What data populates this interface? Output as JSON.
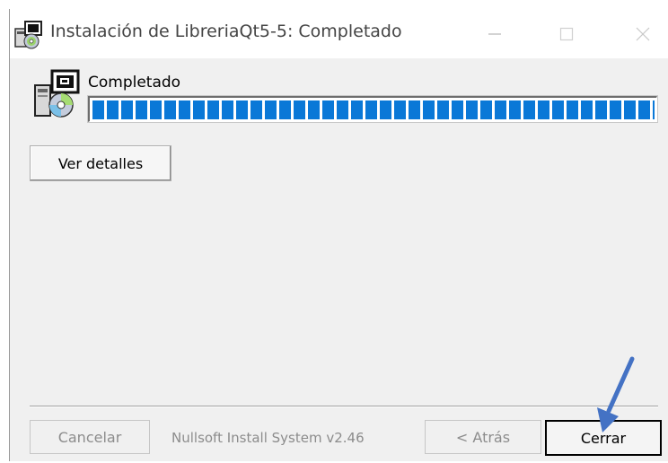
{
  "window": {
    "title": "Instalación de LibreriaQt5-5: Completado",
    "controls": {
      "minimize": "—",
      "maximize": "☐",
      "close": "✕"
    }
  },
  "status": {
    "label": "Completado",
    "progress_percent": 100
  },
  "buttons": {
    "details": "Ver detalles",
    "cancel": "Cancelar",
    "back": "< Atrás",
    "close": "Cerrar"
  },
  "branding": "Nullsoft Install System v2.46",
  "colors": {
    "progress": "#0a78d7",
    "annotation_arrow": "#4472c4"
  },
  "icons": {
    "title": "installer-icon",
    "content": "installer-cd-icon",
    "annotation": "arrow-pointer-icon"
  }
}
